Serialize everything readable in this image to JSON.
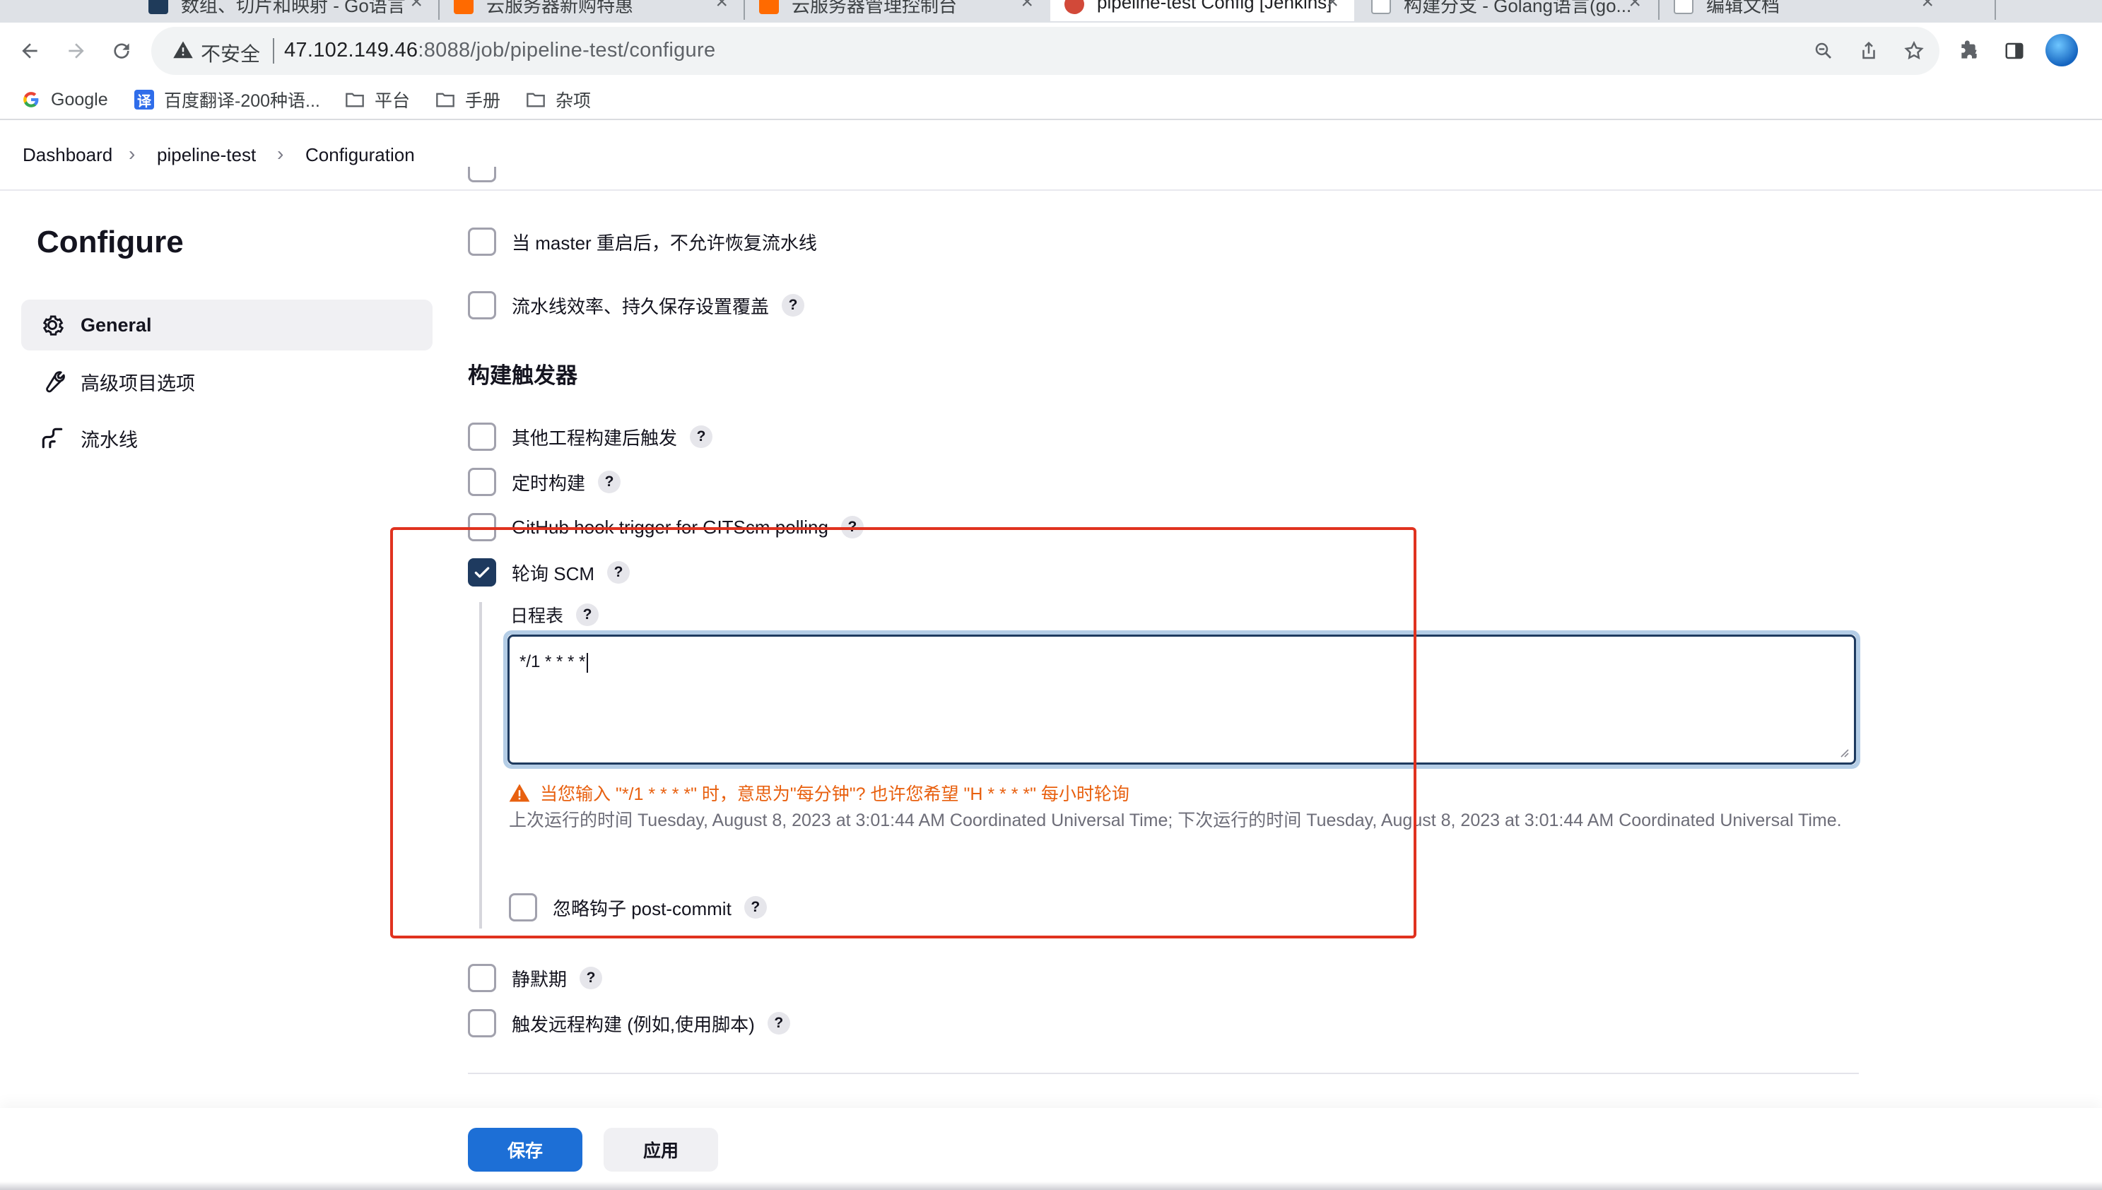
{
  "browser": {
    "tabs": [
      {
        "title": "数组、切片和映射 - Go语言"
      },
      {
        "title": "云服务器新购特惠"
      },
      {
        "title": "云服务器管理控制台"
      },
      {
        "title": "pipeline-test Config [Jenkins]"
      },
      {
        "title": "构建分支 - Golang语言(go..."
      },
      {
        "title": "编辑文档"
      }
    ],
    "address": {
      "security_label": "不安全",
      "host": "47.102.149.46",
      "rest": ":8088/job/pipeline-test/configure"
    },
    "bookmarks": [
      {
        "label": "Google"
      },
      {
        "label": "百度翻译-200种语..."
      },
      {
        "label": "平台"
      },
      {
        "label": "手册"
      },
      {
        "label": "杂项"
      }
    ]
  },
  "breadcrumb": [
    "Dashboard",
    "pipeline-test",
    "Configuration"
  ],
  "sidebar": {
    "title": "Configure",
    "items": [
      {
        "label": "General",
        "icon": "gear-icon",
        "active": true
      },
      {
        "label": "高级项目选项",
        "icon": "wrench-icon",
        "active": false
      },
      {
        "label": "流水线",
        "icon": "pipeline-icon",
        "active": false
      }
    ]
  },
  "general": {
    "options": [
      {
        "label": "当 master 重启后，不允许恢复流水线",
        "checked": false
      },
      {
        "label": "流水线效率、持久保存设置覆盖",
        "checked": false
      }
    ]
  },
  "triggers": {
    "title": "构建触发器",
    "options": [
      {
        "label": "其他工程构建后触发",
        "checked": false
      },
      {
        "label": "定时构建",
        "checked": false
      },
      {
        "label": "GitHub hook trigger for GITScm polling",
        "checked": false
      },
      {
        "label": "轮询 SCM",
        "checked": true
      }
    ],
    "schedule": {
      "label": "日程表",
      "value": "*/1 * * * *",
      "warning": "当您输入 \"*/1 * * * *\" 时，意思为\"每分钟\"? 也许您希望 \"H * * * *\" 每小时轮询",
      "info": "上次运行的时间 Tuesday, August 8, 2023 at 3:01:44 AM Coordinated Universal Time; 下次运行的时间 Tuesday, August 8, 2023 at 3:01:44 AM Coordinated Universal Time."
    },
    "ignore_hook": {
      "label": "忽略钩子 post-commit",
      "checked": false
    },
    "more_options": [
      {
        "label": "静默期",
        "checked": false
      },
      {
        "label": "触发远程构建 (例如,使用脚本)",
        "checked": false
      }
    ]
  },
  "buttons": {
    "save": "保存",
    "apply": "应用"
  },
  "help_glyph": "?",
  "colors": {
    "primary": "#1d6fd6",
    "checkbox_checked": "#1e3a5f",
    "warning": "#e8600f",
    "annotation_box": "#e0321f"
  }
}
